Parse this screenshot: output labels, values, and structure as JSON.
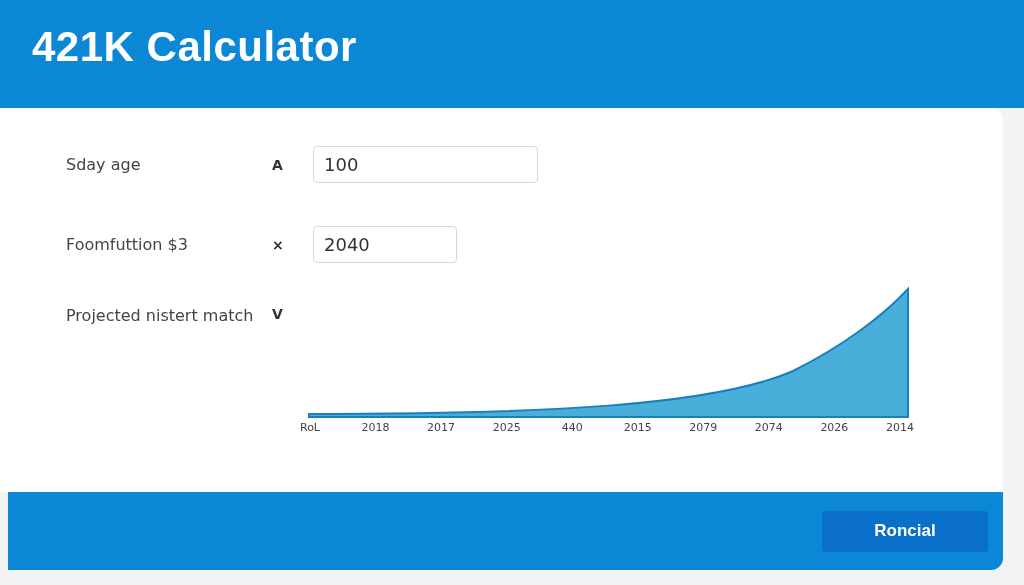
{
  "header": {
    "title": "421K Calculator"
  },
  "fields": [
    {
      "label": "Sday age",
      "symbol": "A",
      "value": "100"
    },
    {
      "label": "Foomfuttion $3",
      "symbol": "×",
      "value": "2040"
    }
  ],
  "projection": {
    "label": "Projected nistert match",
    "symbol": "V",
    "axis_labels": [
      "RoL",
      "2018",
      "2017",
      "2025",
      "440",
      "2015",
      "2079",
      "2074",
      "2026",
      "2014"
    ]
  },
  "footer": {
    "button": "Roncial"
  }
}
